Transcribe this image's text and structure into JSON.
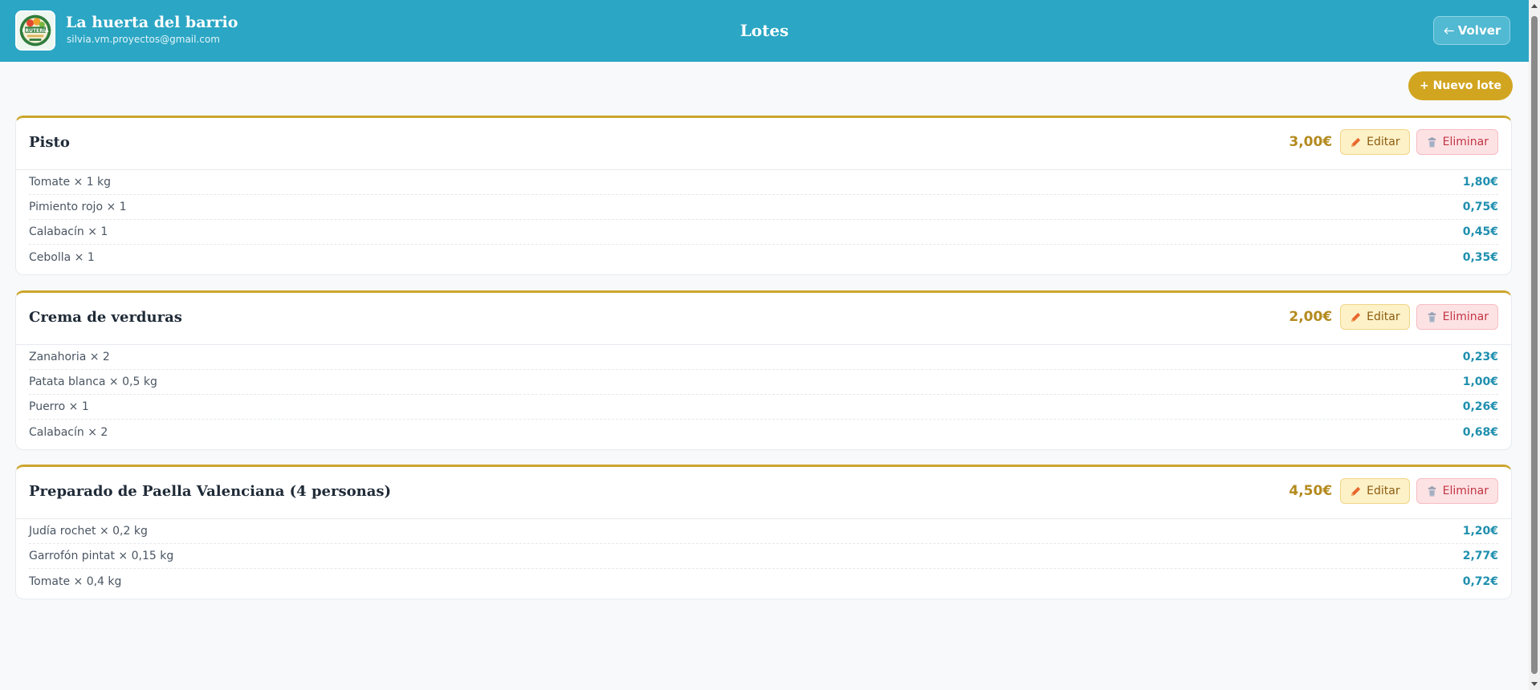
{
  "header": {
    "brand_name": "La huerta del barrio",
    "brand_email": "silvia.vm.proyectos@gmail.com",
    "logo_label": "FRUTERÍA",
    "title": "Lotes",
    "back_label": "Volver"
  },
  "toolbar": {
    "new_label": "+ Nuevo lote"
  },
  "actions": {
    "edit_label": "Editar",
    "delete_label": "Eliminar"
  },
  "lotes": [
    {
      "name": "Pisto",
      "price": "3,00€",
      "items": [
        {
          "label": "Tomate × 1 kg",
          "price": "1,80€"
        },
        {
          "label": "Pimiento rojo × 1",
          "price": "0,75€"
        },
        {
          "label": "Calabacín × 1",
          "price": "0,45€"
        },
        {
          "label": "Cebolla × 1",
          "price": "0,35€"
        }
      ]
    },
    {
      "name": "Crema de verduras",
      "price": "2,00€",
      "items": [
        {
          "label": "Zanahoria × 2",
          "price": "0,23€"
        },
        {
          "label": "Patata blanca × 0,5 kg",
          "price": "1,00€"
        },
        {
          "label": "Puerro × 1",
          "price": "0,26€"
        },
        {
          "label": "Calabacín × 2",
          "price": "0,68€"
        }
      ]
    },
    {
      "name": "Preparado de Paella Valenciana (4 personas)",
      "price": "4,50€",
      "items": [
        {
          "label": "Judía rochet × 0,2 kg",
          "price": "1,20€"
        },
        {
          "label": "Garrofón pintat × 0,15 kg",
          "price": "2,77€"
        },
        {
          "label": "Tomate × 0,4 kg",
          "price": "0,72€"
        }
      ]
    }
  ],
  "colors": {
    "header_bg": "#2ba6c4",
    "accent_gold": "#d2a521",
    "price_gold": "#b48a1e",
    "item_price": "#1f8fae",
    "edit_bg": "#fdf1c8",
    "delete_bg": "#fde2e4"
  },
  "icons": {
    "edit": "pencil-icon",
    "delete": "trash-icon",
    "back": "arrow-left-icon"
  }
}
